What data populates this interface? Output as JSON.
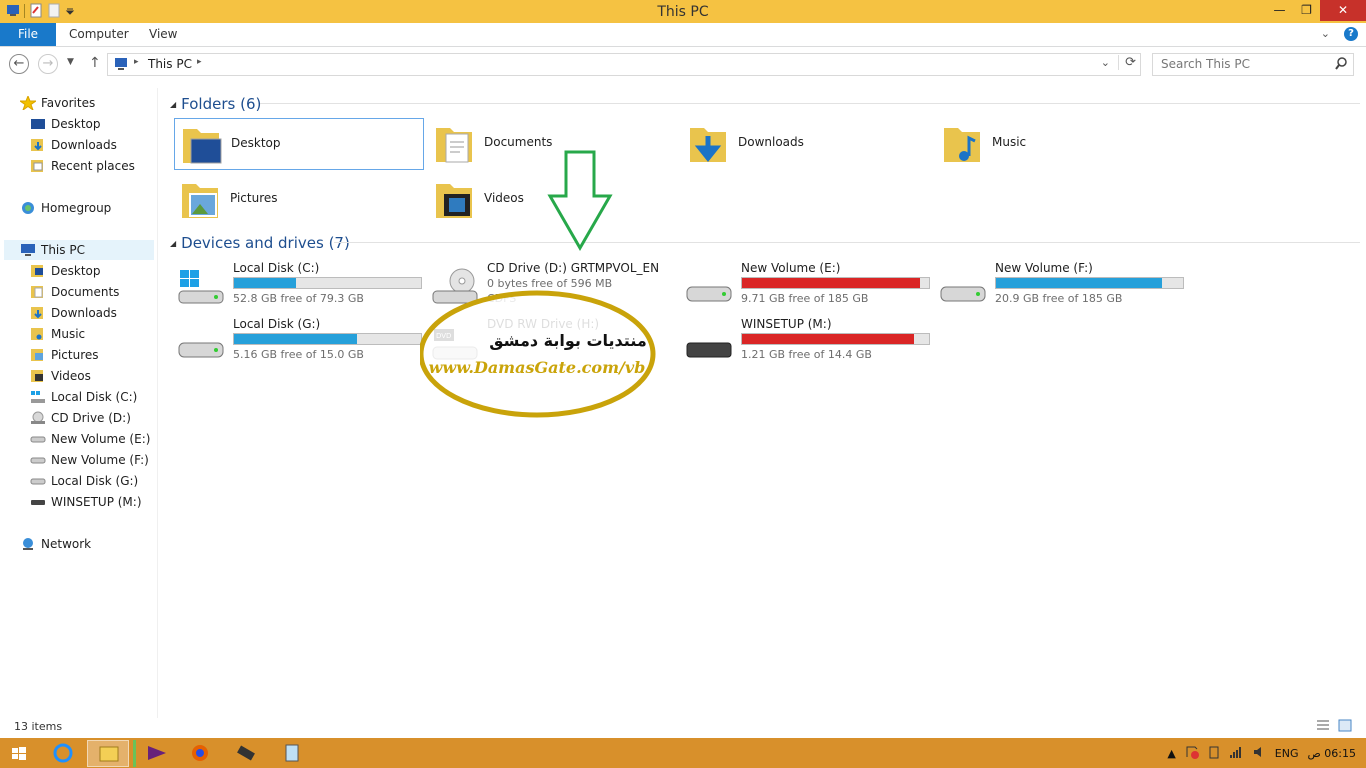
{
  "window": {
    "title": "This PC"
  },
  "ribbon": {
    "tabs": [
      "File",
      "Computer",
      "View"
    ]
  },
  "address": {
    "crumb": "This PC"
  },
  "search": {
    "placeholder": "Search This PC"
  },
  "sidebar": {
    "favorites": {
      "label": "Favorites",
      "items": [
        "Desktop",
        "Downloads",
        "Recent places"
      ]
    },
    "homegroup": "Homegroup",
    "thispc": {
      "label": "This PC",
      "items": [
        "Desktop",
        "Documents",
        "Downloads",
        "Music",
        "Pictures",
        "Videos",
        "Local Disk (C:)",
        "CD Drive (D:)",
        "New Volume (E:)",
        "New Volume (F:)",
        "Local Disk (G:)",
        "WINSETUP (M:)"
      ]
    },
    "network": "Network"
  },
  "folders": {
    "header": "Folders (6)",
    "items": [
      "Desktop",
      "Documents",
      "Downloads",
      "Music",
      "Pictures",
      "Videos"
    ]
  },
  "drives": {
    "header": "Devices and drives (7)",
    "items": [
      {
        "name": "Local Disk (C:)",
        "free": "52.8 GB free of 79.3 GB",
        "used_fraction": 0.33,
        "color": "#26a0da"
      },
      {
        "name": "CD Drive (D:) GRTMPVOL_EN",
        "free": "0 bytes free of 596 MB",
        "extra": "CDFS",
        "used_fraction": null,
        "color": ""
      },
      {
        "name": "New Volume (E:)",
        "free": "9.71 GB free of 185 GB",
        "used_fraction": 0.95,
        "color": "#da2626"
      },
      {
        "name": "New Volume (F:)",
        "free": "20.9 GB free of 185 GB",
        "used_fraction": 0.89,
        "color": "#26a0da"
      },
      {
        "name": "Local Disk (G:)",
        "free": "5.16 GB free of 15.0 GB",
        "used_fraction": 0.66,
        "color": "#26a0da"
      },
      {
        "name": "DVD RW Drive (H:)",
        "free": "",
        "used_fraction": null,
        "color": ""
      },
      {
        "name": "WINSETUP (M:)",
        "free": "1.21 GB free of 14.4 GB",
        "used_fraction": 0.92,
        "color": "#da2626"
      }
    ]
  },
  "status": {
    "items": "13 items"
  },
  "overlay": {
    "arabic": "منتديات بوابة دمشق",
    "url": "www.DamasGate.com/vb"
  },
  "tray": {
    "lang": "ENG",
    "time": "06:15 ص"
  }
}
